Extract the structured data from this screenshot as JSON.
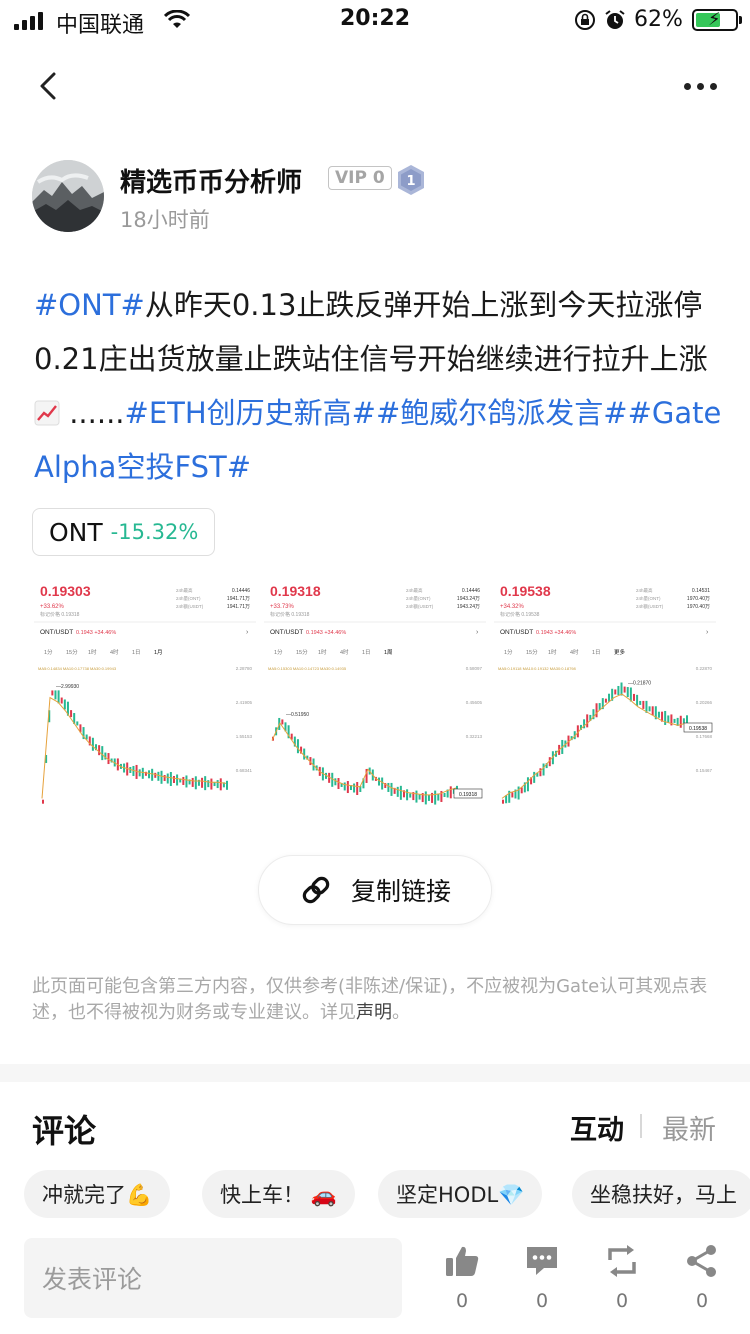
{
  "status_bar": {
    "carrier": "中国联通",
    "time": "20:22",
    "battery_percent": "62%",
    "battery_level": 0.62
  },
  "author": {
    "name": "精选币币分析师",
    "vip": "VIP 0",
    "level": "1",
    "time_ago": "18小时前"
  },
  "post": {
    "parts": [
      {
        "type": "tag",
        "text": "#ONT#"
      },
      {
        "type": "text",
        "text": "从昨天0.13止跌反弹开始上涨到今天拉涨停0.21庄出货放量止跌站住信号开始继续进行拉升上涨"
      },
      {
        "type": "emoji",
        "text": "chart-increasing-emoji"
      },
      {
        "type": "text",
        "text": " ......"
      },
      {
        "type": "tag",
        "text": "#ETH创历史新高#"
      },
      {
        "type": "tag",
        "text": "#鲍威尔鸽派发言#"
      },
      {
        "type": "tag",
        "text": "#Gate Alpha空投FST#"
      }
    ]
  },
  "token": {
    "symbol": "ONT",
    "change": "-15.32%",
    "change_color": "#27b892"
  },
  "images": [
    {
      "price": "0.19303",
      "change_pct": "+33.62%",
      "mark_price": "标记价格 0.19318",
      "stat_labels": [
        "24h最高",
        "24h量(ONT)",
        "24h额(USDT)"
      ],
      "stat_values": [
        "0.14446",
        "1941.71万",
        "1941.71万"
      ],
      "pair": "ONT/USDT",
      "pair_price": "0.1943 +34.46%",
      "intervals": [
        "1分",
        "15分",
        "1时",
        "4时",
        "1日",
        "1月"
      ],
      "ma": "MA5:0.14834 MA10:0.17738 MA30:0.19943",
      "high_label": "2.99930",
      "axis": [
        "2.28780",
        "2.41905",
        "1.55153",
        "0.68341"
      ],
      "last_price": ""
    },
    {
      "price": "0.19318",
      "change_pct": "+33.73%",
      "mark_price": "标记价格 0.19318",
      "stat_labels": [
        "24h最高",
        "24h量(ONT)",
        "24h额(USDT)"
      ],
      "stat_values": [
        "0.14446",
        "1943.24万",
        "1943.24万"
      ],
      "pair": "ONT/USDT",
      "pair_price": "0.1943 +34.46%",
      "intervals": [
        "1分",
        "15分",
        "1时",
        "4时",
        "1日",
        "1周"
      ],
      "ma": "MA5:0.15303 MA10:0.14723 MA30:0.14935",
      "high_label": "0.51950",
      "axis": [
        "0.58097",
        "0.45605",
        "0.32213",
        ""
      ],
      "last_price": "0.19318"
    },
    {
      "price": "0.19538",
      "change_pct": "+34.32%",
      "mark_price": "标记价格 0.19538",
      "stat_labels": [
        "24h最高",
        "24h量(ONT)",
        "24h额(USDT)"
      ],
      "stat_values": [
        "0.14531",
        "1970.40万",
        "1970.40万"
      ],
      "pair": "ONT/USDT",
      "pair_price": "0.1943 +34.46%",
      "intervals": [
        "1分",
        "15分",
        "1时",
        "4时",
        "1日",
        "更多"
      ],
      "ma": "MA5:0.19118 MA10:0.19132 MA30:0.18798",
      "high_label": "0.21870",
      "axis": [
        "0.22870",
        "0.20266",
        "0.17668",
        "0.15467"
      ],
      "last_price": "0.19538"
    }
  ],
  "copy_link": "复制链接",
  "disclaimer": {
    "text": "此页面可能包含第三方内容，仅供参考(非陈述/保证)，不应被视为Gate认可其观点表述，也不得被视为财务或专业建议。详见",
    "link": "声明",
    "end": "。"
  },
  "comments": {
    "title": "评论",
    "tab_interact": "互动",
    "tab_latest": "最新",
    "quick_replies": [
      "冲就完了💪",
      "快上车！ 🚗",
      "坚定HODL💎",
      "坐稳扶好，马上"
    ],
    "input_placeholder": "发表评论",
    "actions": [
      {
        "icon": "thumbs-up-icon",
        "count": "0"
      },
      {
        "icon": "comment-icon",
        "count": "0"
      },
      {
        "icon": "repost-icon",
        "count": "0"
      },
      {
        "icon": "share-icon",
        "count": "0"
      }
    ]
  }
}
